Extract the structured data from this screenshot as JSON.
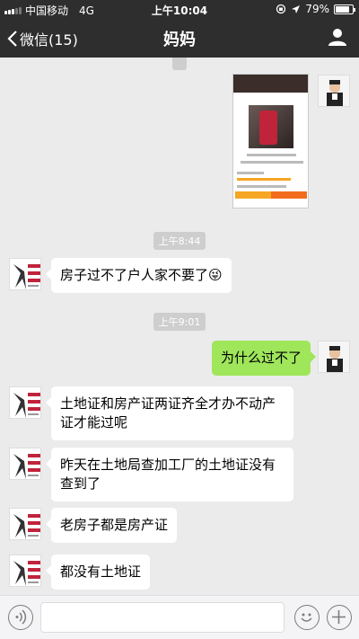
{
  "status_bar": {
    "carrier": "中国移动",
    "network": "4G",
    "time": "上午10:04",
    "battery": "79%",
    "battery_level": 0.79
  },
  "nav": {
    "back_label": "微信(15)",
    "title": "妈妈"
  },
  "chat": {
    "timestamps": [
      "上午8:44",
      "上午9:01"
    ],
    "messages": [
      {
        "from": "contact",
        "text": "房子过不了户人家不要了😜"
      },
      {
        "from": "me",
        "text": "为什么过不了"
      },
      {
        "from": "contact",
        "text": "土地证和房产证两证齐全才办不动产证才能过呢"
      },
      {
        "from": "contact",
        "text": "昨天在土地局查加工厂的土地证没有查到了"
      },
      {
        "from": "contact",
        "text": "老房子都是房产证"
      },
      {
        "from": "contact",
        "text": "都没有土地证"
      }
    ]
  },
  "colors": {
    "nav_bg": "#2e2e2e",
    "chat_bg": "#ebebeb",
    "outgoing_bubble": "#9fe65b",
    "incoming_bubble": "#ffffff"
  },
  "icons": {
    "back": "chevron-left-icon",
    "profile": "person-icon",
    "voice": "voice-icon",
    "emoji": "emoji-icon",
    "more": "plus-icon"
  }
}
